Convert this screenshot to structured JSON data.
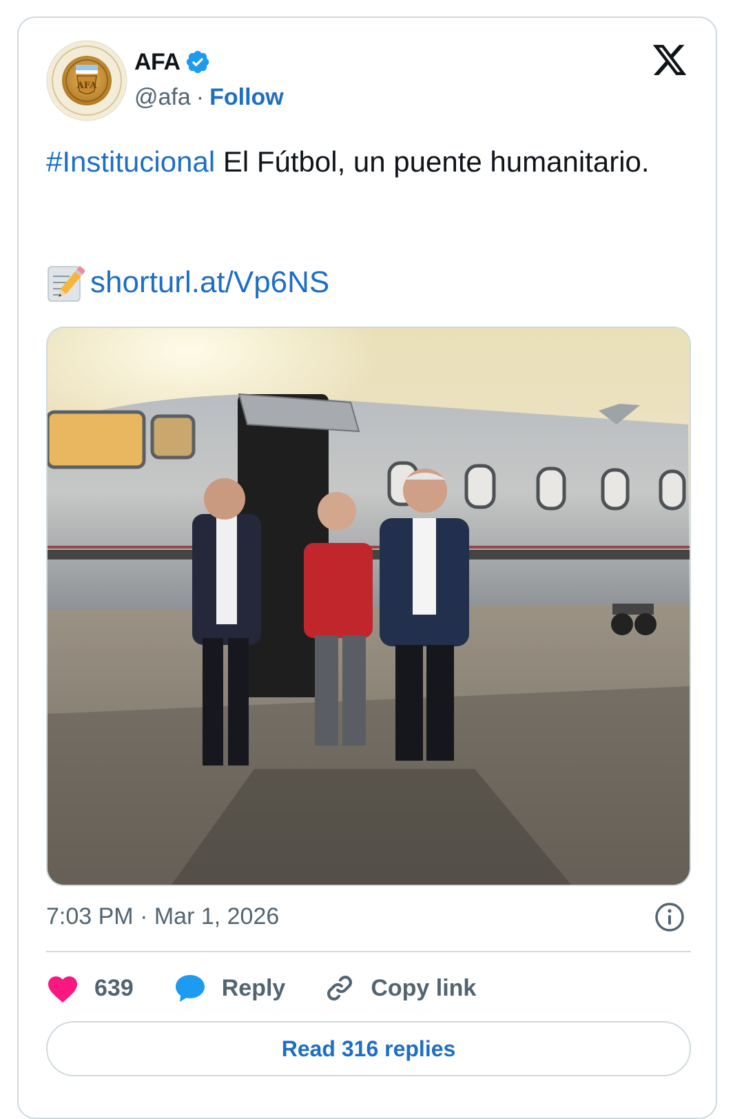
{
  "author": {
    "display_name": "AFA",
    "handle": "@afa",
    "separator": "·",
    "follow_label": "Follow",
    "verified": true,
    "avatar_icon": "afa-crest-avatar"
  },
  "platform_icon": "x-logo-icon",
  "tweet": {
    "hashtag": "#Institucional",
    "text": " El Fútbol, un puente humanitario.",
    "link_icon": "memo-icon",
    "link": "shorturl.at/Vp6NS",
    "image_description_icon": "photo"
  },
  "meta": {
    "timestamp": "7:03 PM · Mar 1, 2026"
  },
  "actions": {
    "like_count": "639",
    "reply_label": "Reply",
    "copy_link_label": "Copy link",
    "read_replies_label": "Read 316 replies"
  },
  "colors": {
    "accent": "#1d6ec5",
    "like": "#f91880",
    "reply": "#1d9bf0",
    "muted": "#536471",
    "border": "#cfd9de"
  }
}
